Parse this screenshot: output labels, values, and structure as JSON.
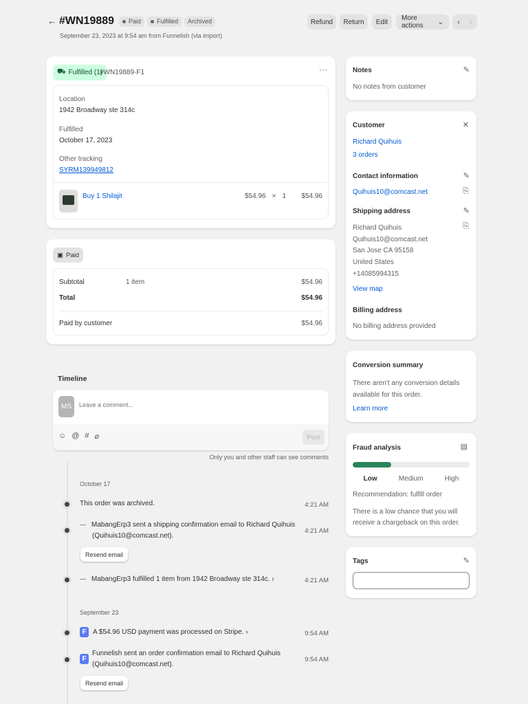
{
  "header": {
    "order_id": "#WN19889",
    "badges": [
      "Paid",
      "Fulfilled",
      "Archived"
    ],
    "subtitle": "September 23, 2023 at 9:54 am from Funnelish (via import)",
    "buttons": {
      "refund": "Refund",
      "return": "Return",
      "edit": "Edit",
      "more": "More actions"
    }
  },
  "fulfillment": {
    "status": "Fulfilled (1)",
    "id": "#WN19889-F1",
    "location_label": "Location",
    "location": "1942 Broadway ste 314c",
    "fulfilled_label": "Fulfilled",
    "fulfilled_date": "October 17, 2023",
    "tracking_label": "Other tracking",
    "tracking": "SYRM139949812",
    "item": {
      "name": "Buy 1 Shilajit",
      "price": "$54.96",
      "multiply": "×",
      "qty": "1",
      "total": "$54.96"
    }
  },
  "payment": {
    "status": "Paid",
    "subtotal_label": "Subtotal",
    "subtotal_items": "1 item",
    "subtotal": "$54.96",
    "total_label": "Total",
    "total": "$54.96",
    "paid_label": "Paid by customer",
    "paid": "$54.96"
  },
  "timeline": {
    "title": "Timeline",
    "avatar": "MS",
    "placeholder": "Leave a comment...",
    "post": "Post",
    "note": "Only you and other staff can see comments",
    "resend": "Resend email",
    "groups": [
      {
        "date": "October 17",
        "events": [
          {
            "text": "This order was archived.",
            "time": "4:21 AM"
          },
          {
            "text": "MabangErp3 sent a shipping confirmation email to Richard Quihuis",
            "text2": "(Quihuis10@comcast.net).",
            "time": "4:21 AM"
          },
          {
            "text": "MabangErp3 fulfilled 1 item from 1942 Broadway ste 314c.",
            "time": "4:21 AM"
          }
        ]
      },
      {
        "date": "September 23",
        "events": [
          {
            "text": "A $54.96 USD payment was processed on Stripe.",
            "time": "9:54 AM"
          },
          {
            "text": "Funnelish sent an order confirmation email to Richard Quihuis",
            "text2": "(Quihuis10@comcast.net).",
            "time": "9:54 AM"
          }
        ]
      }
    ]
  },
  "notes": {
    "title": "Notes",
    "text": "No notes from customer"
  },
  "customer": {
    "title": "Customer",
    "name": "Richard Quihuis",
    "orders": "3 orders",
    "contact_title": "Contact information",
    "email": "Quihuis10@comcast.net",
    "shipping_title": "Shipping address",
    "shipping": [
      "Richard Quihuis",
      "Quihuis10@comcast.net",
      "San Jose CA 95158",
      "United States",
      "+14085994315"
    ],
    "view_map": "View map",
    "billing_title": "Billing address",
    "billing": "No billing address provided"
  },
  "conversion": {
    "title": "Conversion summary",
    "text1": "There aren't any conversion details",
    "text2": "available for this order.",
    "learn": "Learn more"
  },
  "fraud": {
    "title": "Fraud analysis",
    "level_fraction": 0.33,
    "levels": [
      "Low",
      "Medium",
      "High"
    ],
    "recommendation": "Recommendation: fulfill order",
    "text1": "There is a low chance that you will",
    "text2": "receive a chargeback on this order."
  },
  "tags": {
    "title": "Tags",
    "value": ""
  }
}
